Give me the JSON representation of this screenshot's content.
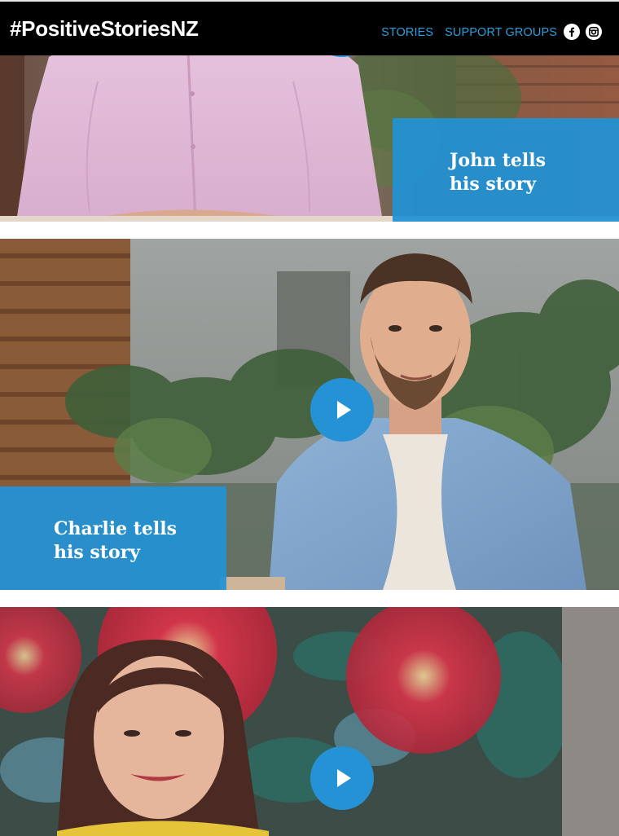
{
  "header": {
    "logo_text": "#PositiveStoriesNZ",
    "nav": [
      {
        "label": "STORIES"
      },
      {
        "label": "SUPPORT GROUPS"
      }
    ],
    "social": [
      {
        "icon": "facebook-icon"
      },
      {
        "icon": "instagram-icon"
      }
    ]
  },
  "stories": [
    {
      "caption": "John tells\nhis story",
      "play_icon": "play-icon"
    },
    {
      "caption": "Charlie tells\nhis story",
      "play_icon": "play-icon"
    },
    {
      "caption": "",
      "play_icon": "play-icon"
    }
  ],
  "colors": {
    "header_bg": "#000000",
    "accent": "#2592d6",
    "nav_link": "#2a9fdb",
    "caption_bg": "#2192d4"
  }
}
